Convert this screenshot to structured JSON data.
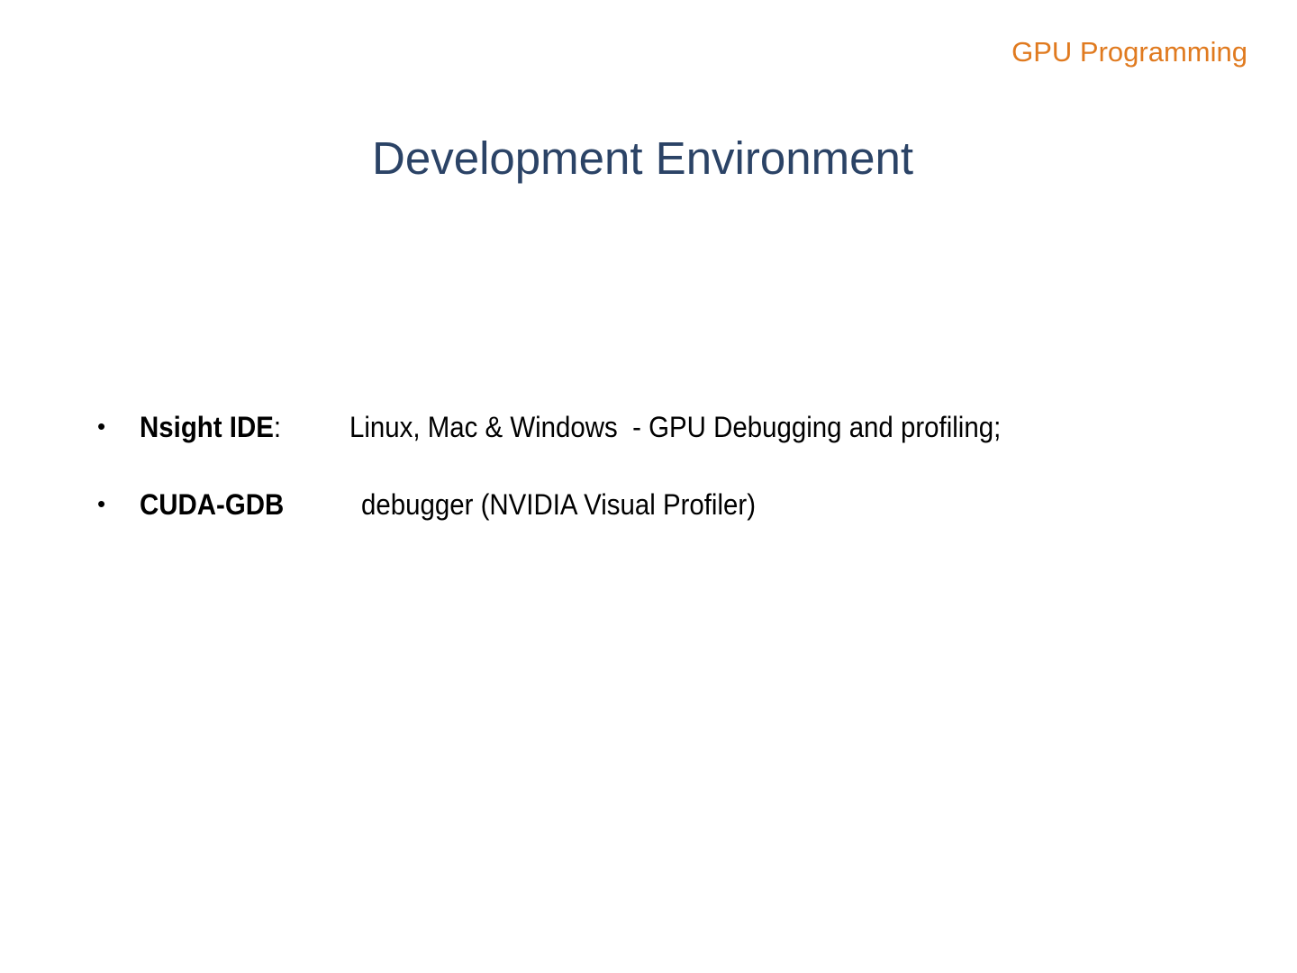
{
  "header": {
    "course": "GPU Programming"
  },
  "slide": {
    "title": "Development Environment",
    "bullets": [
      {
        "term": "Nsight IDE",
        "separator": ":",
        "description": "Linux, Mac & Windows  - GPU Debugging and profiling;"
      },
      {
        "term": "CUDA-GDB",
        "separator": "",
        "description": "debugger (NVIDIA Visual Profiler)"
      }
    ]
  },
  "colors": {
    "header": "#e07a1f",
    "title": "#2b4366"
  }
}
